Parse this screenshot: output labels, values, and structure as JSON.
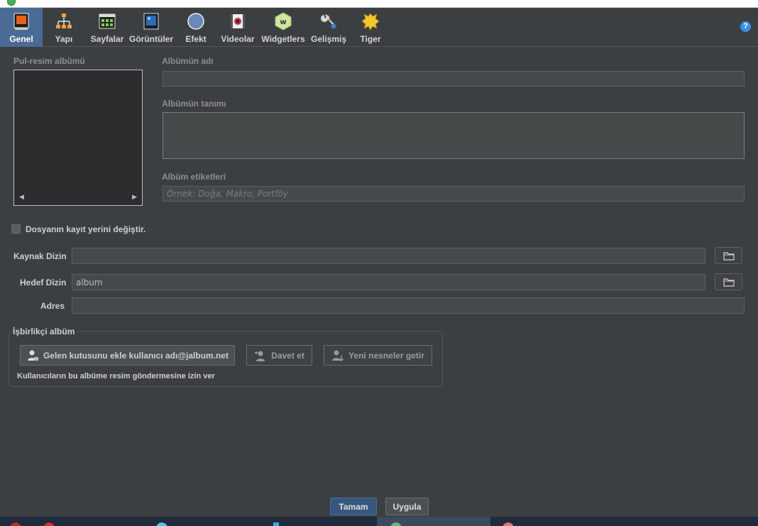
{
  "toolbar": {
    "tabs": [
      {
        "label": "Genel",
        "icon": "general-icon"
      },
      {
        "label": "Yapı",
        "icon": "structure-icon"
      },
      {
        "label": "Sayfalar",
        "icon": "pages-icon"
      },
      {
        "label": "Görüntüler",
        "icon": "images-icon"
      },
      {
        "label": "Efekt",
        "icon": "effect-icon"
      },
      {
        "label": "Videolar",
        "icon": "video-icon"
      },
      {
        "label": "Widgetlers",
        "icon": "widget-icon"
      },
      {
        "label": "Gelişmiş",
        "icon": "wrench-icon"
      },
      {
        "label": "Tiger",
        "icon": "tiger-skin-icon"
      }
    ],
    "help": "?"
  },
  "album": {
    "thumbnail_label": "Pul-resim albümü",
    "name_label": "Albümün adı",
    "name_value": "",
    "description_label": "Albümün tanımı",
    "description_value": "",
    "tags_label": "Albüm etiketleri",
    "tags_placeholder": "Örnek: Doğa, Makro, Portföy"
  },
  "file_location": {
    "checkbox_label": "Dosyanın kayıt yerini değiştir.",
    "checked": false
  },
  "paths": {
    "source_label": "Kaynak Dizin",
    "source_value": "",
    "target_label": "Hedef Dizin",
    "target_value": "album",
    "address_label": "Adres",
    "address_value": ""
  },
  "collab": {
    "title": "İşbirlikçi albüm",
    "inbox_button": "Gelen kutusunu ekle kullanıcı adı@jalbum.net",
    "invite_button": "Davet et",
    "fetch_button": "Yeni nesneler getir",
    "note": "Kullanıcıların bu albüme resim göndermesine izin ver"
  },
  "footer": {
    "ok": "Tamam",
    "apply": "Uygula"
  },
  "colors": {
    "background": "#3c3f41",
    "active_tab": "#4a6b96",
    "primary_button": "#365880"
  }
}
